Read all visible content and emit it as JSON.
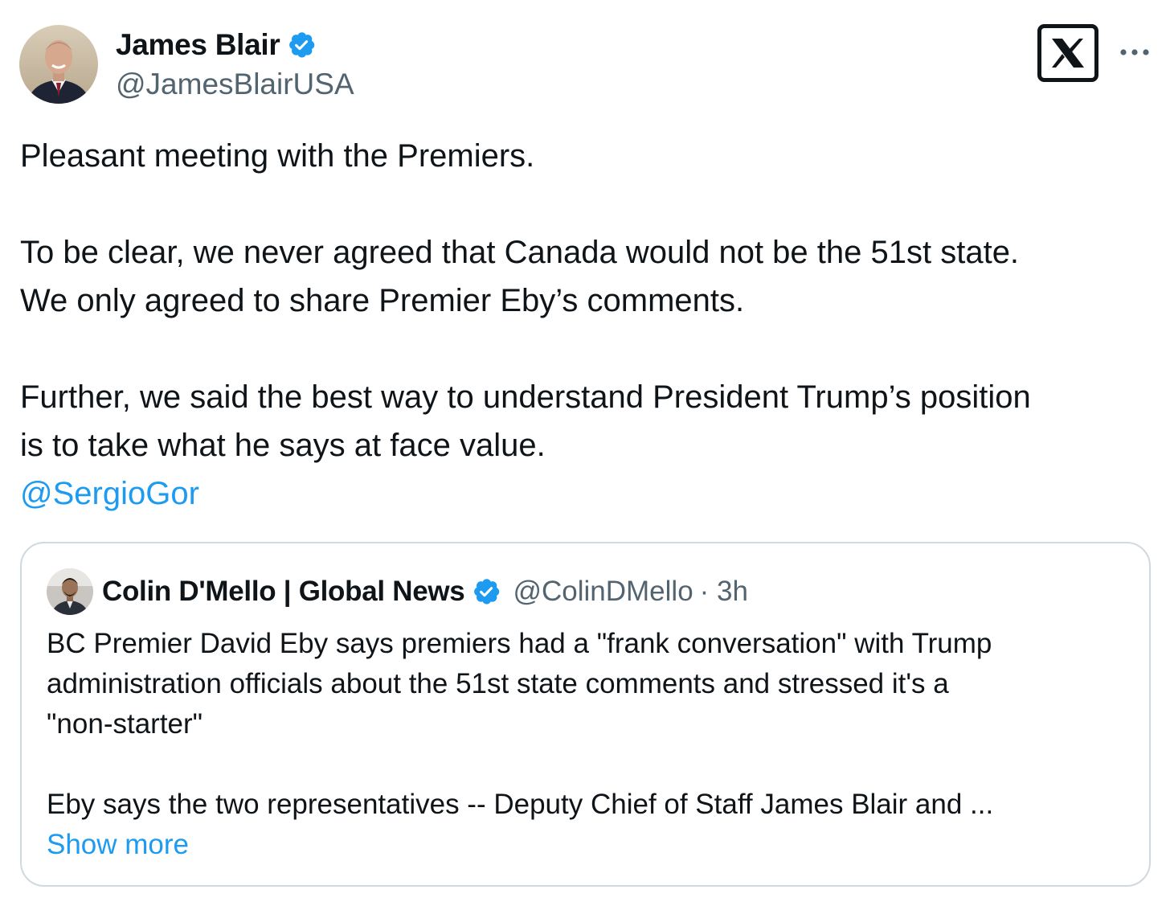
{
  "author": {
    "display_name": "James Blair",
    "handle": "@JamesBlairUSA",
    "verified_icon": "verified-badge-icon"
  },
  "tweet": {
    "paragraphs": [
      [
        "Pleasant meeting with the Premiers."
      ],
      [
        "To be clear, we never agreed that Canada would not be the 51st state.",
        "We only agreed to share Premier Eby’s comments."
      ],
      [
        "Further, we said the best way to understand President Trump’s position",
        "is to take what he says at face value."
      ]
    ],
    "mention": "@SergioGor"
  },
  "quote": {
    "display_name": "Colin D'Mello | Global News",
    "handle": "@ColinDMello",
    "time": "· 3h",
    "paragraphs": [
      [
        "BC Premier David Eby says premiers had a \"frank conversation\" with Trump",
        "administration officials about the 51st state comments and stressed it's a",
        "\"non-starter\""
      ],
      [
        "Eby says the two representatives -- Deputy Chief of Staff James Blair and ..."
      ]
    ],
    "show_more": "Show more"
  },
  "icons": {
    "logo": "x-logo-icon",
    "more": "more-icon"
  },
  "colors": {
    "link": "#1d9bf0",
    "verified": "#1d9bf0",
    "secondary_text": "#536471",
    "border": "#cfd9de"
  }
}
